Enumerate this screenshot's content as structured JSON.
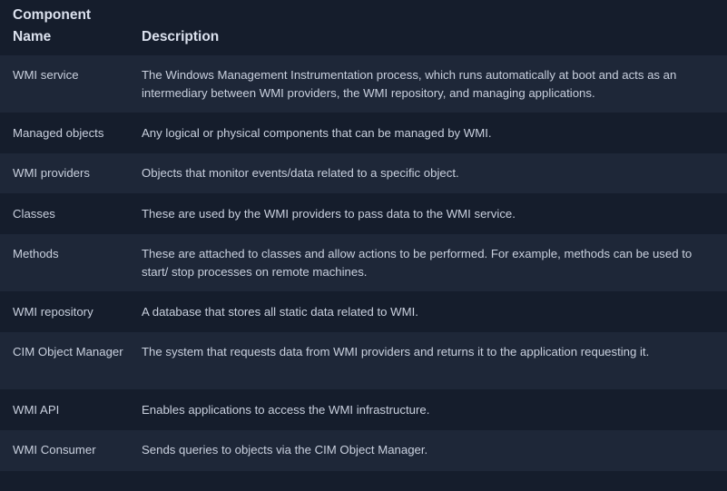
{
  "header": {
    "component_name": "Component Name",
    "description": "Description"
  },
  "rows": [
    {
      "component": "WMI service",
      "description": "The Windows Management Instrumentation process, which runs automatically at boot and acts as an intermediary between WMI providers, the WMI repository, and managing applications."
    },
    {
      "component": "Managed objects",
      "description": "Any logical or physical components that can be managed by WMI."
    },
    {
      "component": "WMI providers",
      "description": "Objects that monitor events/data related to a specific object."
    },
    {
      "component": "Classes",
      "description": "These are used by the WMI providers to pass data to the WMI service."
    },
    {
      "component": "Methods",
      "description": "These are attached to classes and allow actions to be performed. For example, methods can be used to start/ stop processes on remote machines."
    },
    {
      "component": "WMI repository",
      "description": "A database that stores all static data related to WMI."
    },
    {
      "component": "CIM Object Manager",
      "description": "The system that requests data from WMI providers and returns it to the application requesting it."
    },
    {
      "component": "WMI API",
      "description": "Enables applications to access the WMI infrastructure."
    },
    {
      "component": "WMI Consumer",
      "description": "Sends queries to objects via the CIM Object Manager."
    }
  ]
}
